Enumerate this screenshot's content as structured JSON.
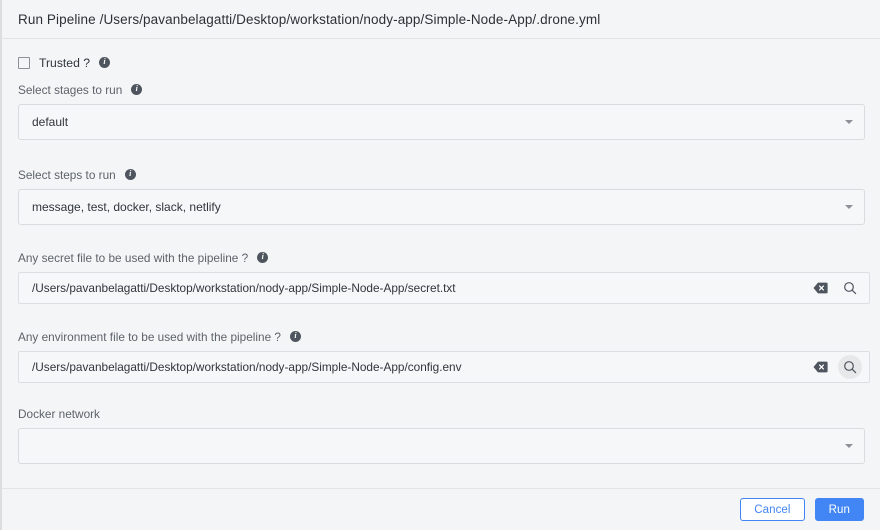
{
  "dialog": {
    "title": "Run Pipeline /Users/pavanbelagatti/Desktop/workstation/nody-app/Simple-Node-App/.drone.yml"
  },
  "trusted": {
    "label": "Trusted ?",
    "checked": false,
    "info": "i"
  },
  "fields": {
    "stages": {
      "label": "Select stages to run",
      "info": "i",
      "value": "default"
    },
    "steps": {
      "label": "Select steps to run",
      "info": "i",
      "value": "message, test, docker, slack, netlify"
    },
    "secret_file": {
      "label": "Any secret file to be used with the pipeline ?",
      "info": "i",
      "value": "/Users/pavanbelagatti/Desktop/workstation/nody-app/Simple-Node-App/secret.txt"
    },
    "env_file": {
      "label": "Any environment file to be used with the pipeline ?",
      "info": "i",
      "value": "/Users/pavanbelagatti/Desktop/workstation/nody-app/Simple-Node-App/config.env"
    },
    "docker_network": {
      "label": "Docker network",
      "value": ""
    }
  },
  "icons": {
    "clear": "clear-icon",
    "browse": "search-icon",
    "caret": "chevron-down-icon"
  },
  "footer": {
    "cancel_label": "Cancel",
    "run_label": "Run"
  },
  "colors": {
    "accent": "#4285f4",
    "background": "#f4f5f6",
    "border": "#d9dcdf",
    "text": "#30353c",
    "label": "#5d636b",
    "info_badge": "#4e555e"
  }
}
